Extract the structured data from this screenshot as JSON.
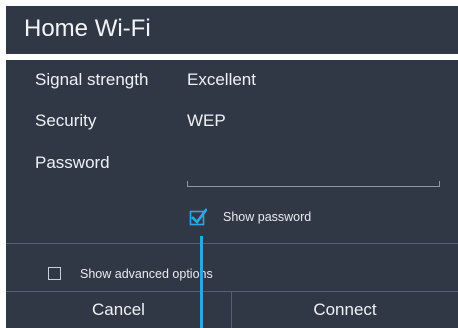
{
  "dialog": {
    "title": "Home Wi-Fi",
    "rows": {
      "signal": {
        "label": "Signal strength",
        "value": "Excellent"
      },
      "security": {
        "label": "Security",
        "value": "WEP"
      },
      "password": {
        "label": "Password",
        "value": ""
      }
    },
    "show_password": {
      "label": "Show password",
      "checked": true
    },
    "advanced": {
      "label": "Show advanced options",
      "checked": false
    },
    "buttons": {
      "cancel": "Cancel",
      "connect": "Connect"
    }
  },
  "colors": {
    "background": "#303846",
    "accent": "#2ea7e0",
    "divider": "#566070",
    "text": "#eef1f5"
  },
  "icons": {
    "show_password_checkbox": "checkbox-checked-icon",
    "advanced_checkbox": "checkbox-empty-icon"
  }
}
